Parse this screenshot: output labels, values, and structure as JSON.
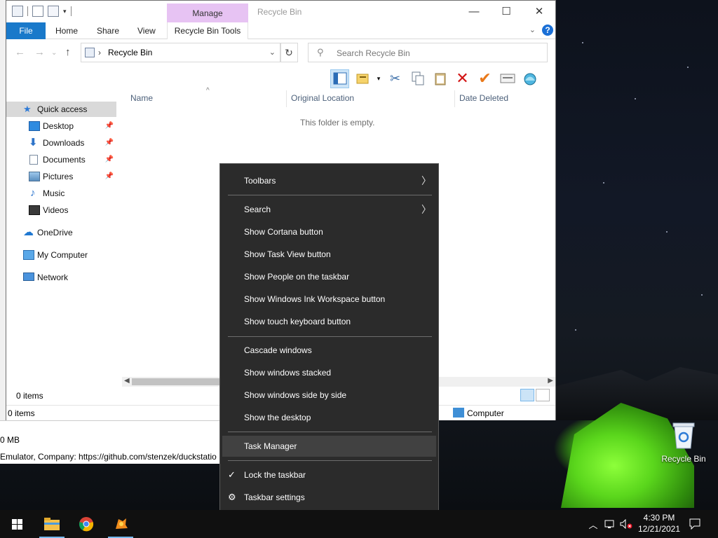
{
  "explorer": {
    "title": "Recycle Bin",
    "manage_tab": "Manage",
    "ribbon_tabs": {
      "file": "File",
      "home": "Home",
      "share": "Share",
      "view": "View",
      "tools": "Recycle Bin Tools"
    },
    "help": "?",
    "address": "Recycle Bin",
    "search_placeholder": "Search Recycle Bin",
    "nav_pane": [
      {
        "label": "Quick access",
        "icon": "star-icon"
      },
      {
        "label": "Desktop",
        "icon": "desktop-folder-icon",
        "pinned": true
      },
      {
        "label": "Downloads",
        "icon": "download-arrow-icon",
        "pinned": true
      },
      {
        "label": "Documents",
        "icon": "document-icon",
        "pinned": true
      },
      {
        "label": "Pictures",
        "icon": "pictures-icon",
        "pinned": true
      },
      {
        "label": "Music",
        "icon": "music-note-icon"
      },
      {
        "label": "Videos",
        "icon": "film-icon"
      },
      {
        "label": "OneDrive",
        "icon": "cloud-icon"
      },
      {
        "label": "My Computer",
        "icon": "computer-icon"
      },
      {
        "label": "Network",
        "icon": "network-icon"
      }
    ],
    "columns": {
      "name": "Name",
      "original_location": "Original Location",
      "date_deleted": "Date Deleted"
    },
    "empty_message": "This folder is empty.",
    "status_items": "0 items",
    "status_items_2": "0 items",
    "status_location": "Computer"
  },
  "background_window": {
    "size_text": "0 MB",
    "company_text": "Emulator, Company: https://github.com/stenzek/duckstatio"
  },
  "context_menu": {
    "items": [
      {
        "label": "Toolbars",
        "submenu": true
      },
      {
        "label": "Search",
        "submenu": true
      },
      {
        "label": "Show Cortana button"
      },
      {
        "label": "Show Task View button"
      },
      {
        "label": "Show People on the taskbar"
      },
      {
        "label": "Show Windows Ink Workspace button"
      },
      {
        "label": "Show touch keyboard button"
      },
      {
        "label": "Cascade windows"
      },
      {
        "label": "Show windows stacked"
      },
      {
        "label": "Show windows side by side"
      },
      {
        "label": "Show the desktop"
      },
      {
        "label": "Task Manager",
        "highlighted": true
      },
      {
        "label": "Lock the taskbar",
        "checked": true
      },
      {
        "label": "Taskbar settings",
        "icon": "gear-icon"
      }
    ]
  },
  "desktop": {
    "recycle_bin_label": "Recycle Bin"
  },
  "taskbar": {
    "time": "4:30 PM",
    "date": "12/21/2021",
    "apps": [
      "start-icon",
      "file-explorer-icon",
      "chrome-icon",
      "duckstation-icon"
    ],
    "accent": "#76b9ed"
  }
}
